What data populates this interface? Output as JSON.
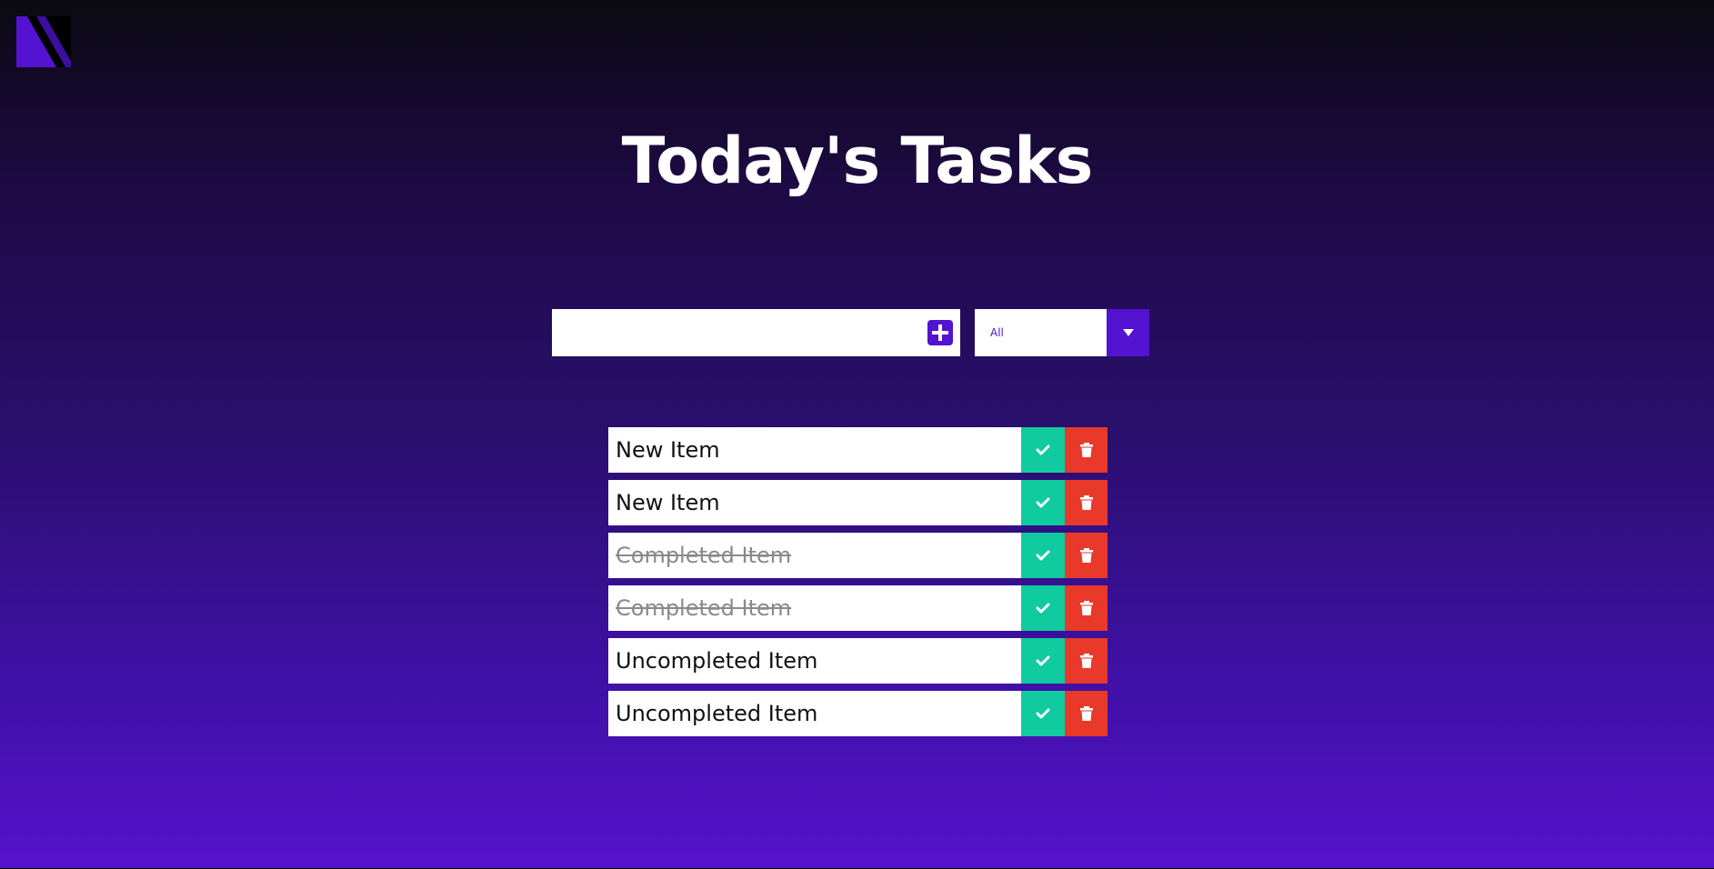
{
  "app": {
    "title": "Today's Tasks"
  },
  "input": {
    "value": "",
    "placeholder": ""
  },
  "filter": {
    "selected": "All"
  },
  "todos": [
    {
      "text": "New Item",
      "completed": false
    },
    {
      "text": "New Item",
      "completed": false
    },
    {
      "text": "Completed Item",
      "completed": true
    },
    {
      "text": "Completed Item",
      "completed": true
    },
    {
      "text": "Uncompleted Item",
      "completed": false
    },
    {
      "text": "Uncompleted Item",
      "completed": false
    }
  ],
  "icons": {
    "logo": "brand-logo-icon",
    "add": "plus-square-icon",
    "dropdown": "caret-down-icon",
    "check": "check-icon",
    "trash": "trash-icon"
  },
  "colors": {
    "accent": "#5313d1",
    "check": "#10cba0",
    "trash": "#e8392b"
  }
}
